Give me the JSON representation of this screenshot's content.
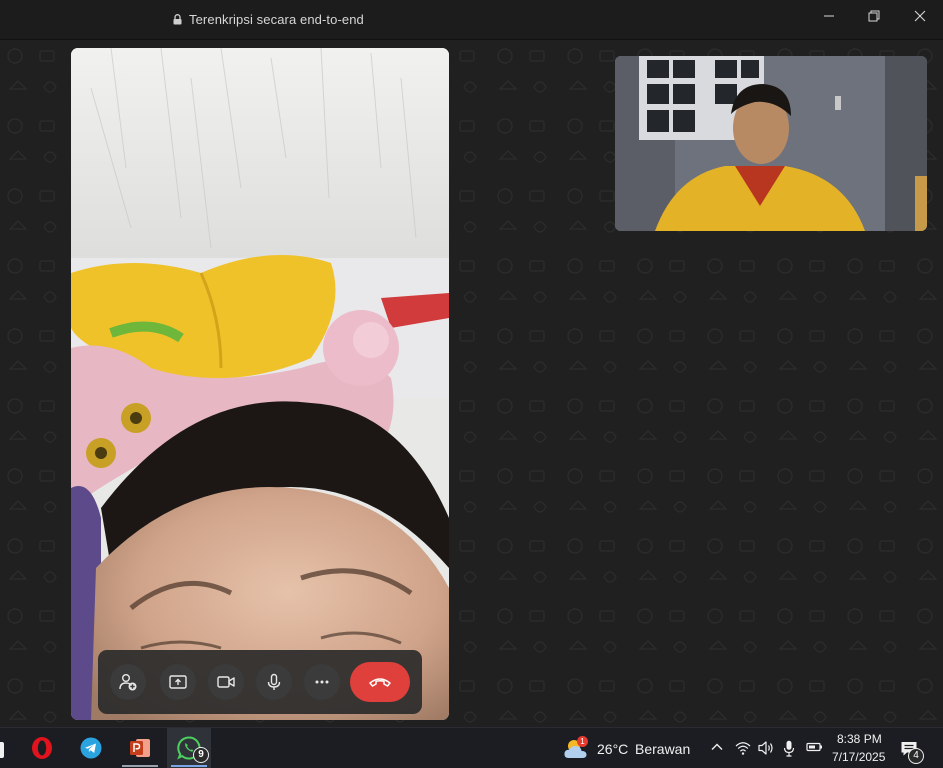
{
  "window": {
    "title": "Terenkripsi secara end-to-end",
    "lock_icon": "lock-icon",
    "controls": [
      "minimize-icon",
      "restore-icon",
      "close-icon"
    ]
  },
  "call": {
    "main_video": "remote participant video feed",
    "self_view": "local camera preview",
    "controls": [
      {
        "name": "add-participant-button",
        "icon": "person-add-icon"
      },
      {
        "name": "share-screen-button",
        "icon": "share-screen-icon"
      },
      {
        "name": "video-toggle-button",
        "icon": "video-camera-icon"
      },
      {
        "name": "mute-button",
        "icon": "microphone-icon"
      },
      {
        "name": "more-options-button",
        "icon": "more-horizontal-icon"
      },
      {
        "name": "end-call-button",
        "icon": "hang-up-icon",
        "color": "#e0403b"
      }
    ]
  },
  "taskbar": {
    "apps": [
      {
        "name": "opera",
        "icon": "opera-icon"
      },
      {
        "name": "telegram",
        "icon": "telegram-icon"
      },
      {
        "name": "powerpoint",
        "icon": "powerpoint-icon"
      },
      {
        "name": "whatsapp",
        "icon": "whatsapp-icon",
        "badge": "9",
        "active": true
      }
    ],
    "weather": {
      "temp": "26°C",
      "condition": "Berawan",
      "alert_badge": "1"
    },
    "clock": {
      "time": "8:38 PM",
      "date": "7/17/2025"
    },
    "notifications": {
      "count": "4"
    }
  }
}
